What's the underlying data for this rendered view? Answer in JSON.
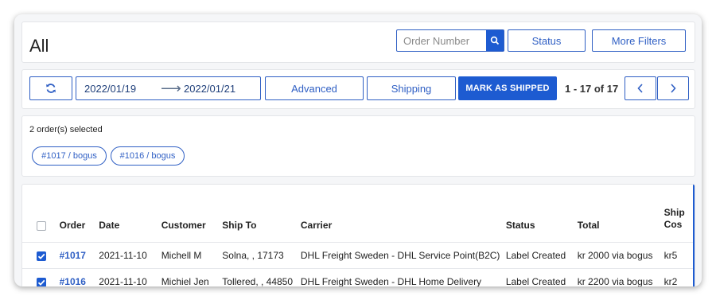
{
  "header": {
    "title": "All",
    "search_placeholder": "Order Number",
    "status_label": "Status",
    "more_filters_label": "More Filters"
  },
  "toolbar": {
    "refresh_icon": "refresh-icon",
    "date_from": "2022/01/19",
    "date_arrow": "⟶",
    "date_to": "2022/01/21",
    "advanced_label": "Advanced",
    "shipping_label": "Shipping",
    "mark_shipped_label": "MARK AS SHIPPED",
    "pager_text": "1 - 17 of 17",
    "prev_icon": "chevron-left-icon",
    "next_icon": "chevron-right-icon"
  },
  "selection": {
    "summary": "2 order(s) selected",
    "chips": [
      "#1017 / bogus",
      "#1016 / bogus"
    ]
  },
  "table": {
    "headers": [
      "Order",
      "Date",
      "Customer",
      "Ship To",
      "Carrier",
      "Status",
      "Total",
      "Ship",
      "Cos"
    ],
    "rows": [
      {
        "order": "#1017",
        "date": "2021-11-10",
        "customer": "Michell M",
        "ship_to": "Solna, , 17173",
        "carrier": "DHL Freight Sweden - DHL Service Point(B2C)",
        "status": "Label Created",
        "total": "kr 2000 via bogus",
        "ship_cost": "kr5",
        "checked": true
      },
      {
        "order": "#1016",
        "date": "2021-11-10",
        "customer": "Michiel Jen",
        "ship_to": "Tollered, , 44850",
        "carrier": "DHL Freight Sweden - DHL Home Delivery",
        "status": "Label Created",
        "total": "kr 2200 via bogus",
        "ship_cost": "kr2",
        "checked": true
      }
    ]
  },
  "colors": {
    "accent": "#1d5bd1",
    "accent_border": "#2f5fc4",
    "scroll_indicator": "#1d5bd1"
  }
}
